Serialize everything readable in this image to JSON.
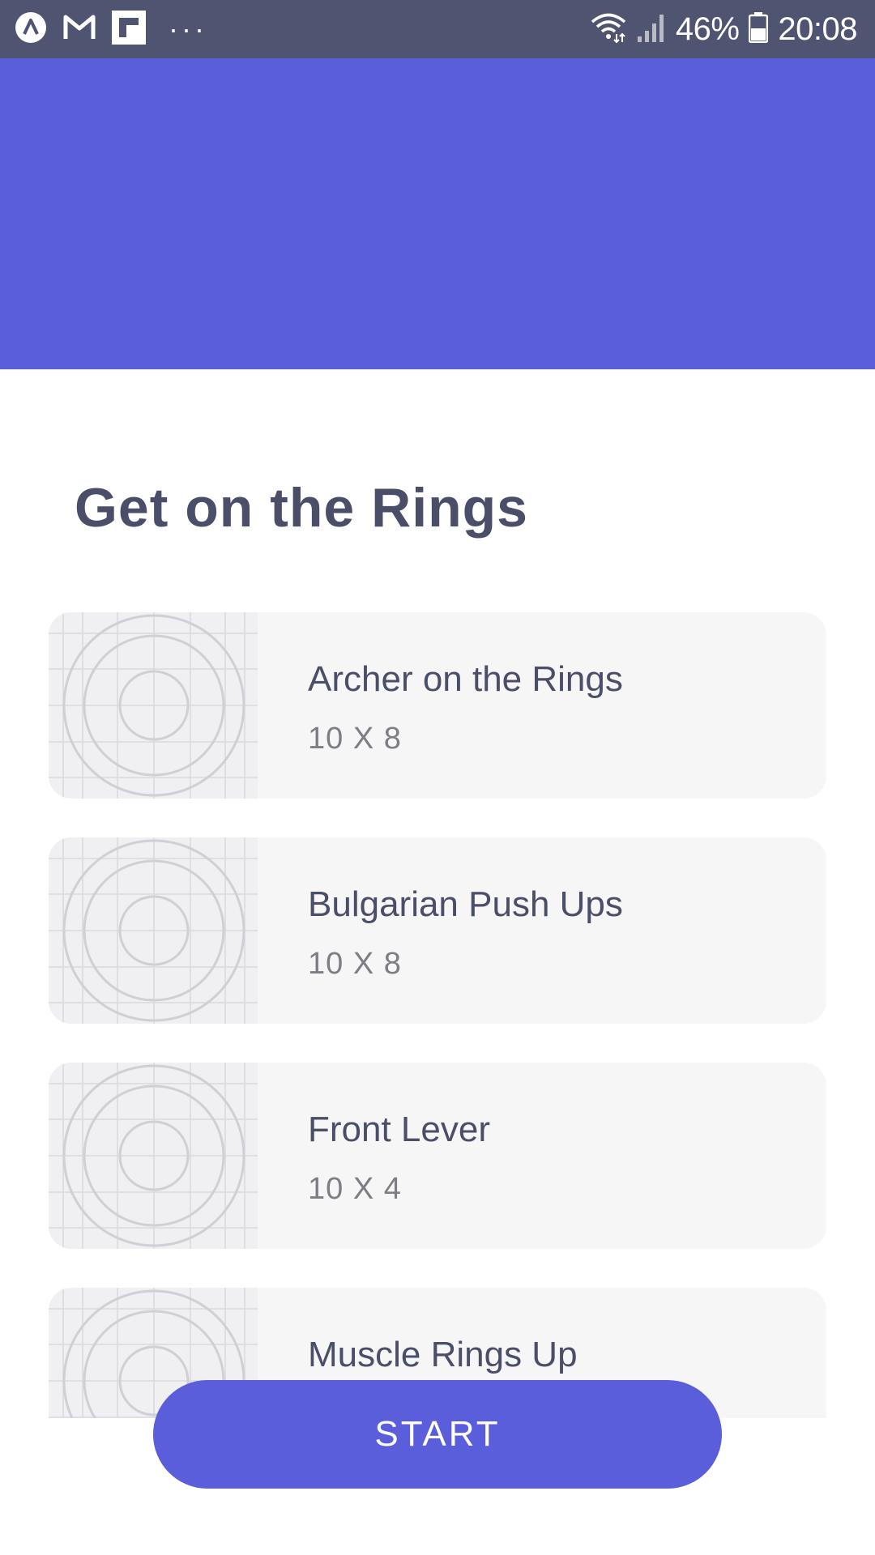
{
  "status_bar": {
    "notification_icons": [
      "app-a-icon",
      "gmail-icon",
      "flipboard-icon"
    ],
    "more_indicator": "···",
    "battery_percent": "46%",
    "time": "20:08"
  },
  "colors": {
    "accent": "#5a5edb",
    "status_bar": "#4f5470",
    "card_background": "#f6f6f7",
    "title_text": "#4b4e68"
  },
  "page": {
    "title": "Get on the Rings"
  },
  "exercises": [
    {
      "name": "Archer on the Rings",
      "sets": "10 X 8"
    },
    {
      "name": "Bulgarian Push Ups",
      "sets": "10 X 8"
    },
    {
      "name": "Front Lever",
      "sets": "10 X 4"
    },
    {
      "name": "Muscle Rings Up",
      "sets": ""
    }
  ],
  "actions": {
    "start_label": "START"
  }
}
